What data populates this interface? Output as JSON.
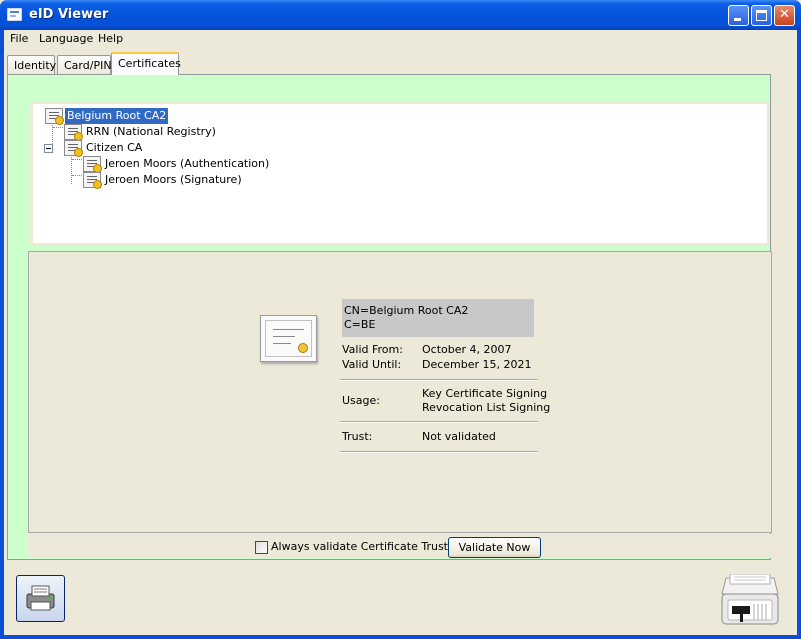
{
  "window": {
    "title": "eID Viewer"
  },
  "menu": [
    "File",
    "Language",
    "Help"
  ],
  "tabs": [
    "Identity",
    "Card/PIN",
    "Certificates"
  ],
  "active_tab": "Certificates",
  "tree": {
    "nodes": [
      {
        "label": "Belgium Root CA2",
        "selected": true
      },
      {
        "label": "RRN (National Registry)"
      },
      {
        "label": "Citizen CA"
      },
      {
        "label": "Jeroen Moors (Authentication)"
      },
      {
        "label": "Jeroen Moors (Signature)"
      }
    ]
  },
  "details": {
    "subject_cn": "CN=Belgium Root CA2",
    "subject_c": "C=BE",
    "valid_from_label": "Valid From:",
    "valid_from": "October 4, 2007",
    "valid_until_label": "Valid Until:",
    "valid_until": "December 15, 2021",
    "usage_label": "Usage:",
    "usage_1": "Key Certificate Signing",
    "usage_2": "Revocation List Signing",
    "trust_label": "Trust:",
    "trust": "Not validated"
  },
  "footer": {
    "always_validate_label": "Always validate Certificate Trust",
    "always_validate_checked": false,
    "validate_button": "Validate Now"
  },
  "colors": {
    "panel": "#ccffcc",
    "selection": "#316ac5",
    "titlebar": "#0453d9"
  },
  "icons": [
    "app-icon",
    "minimize-icon",
    "maximize-icon",
    "close-icon",
    "certificate-icon",
    "print-icon",
    "card-reader-icon"
  ]
}
